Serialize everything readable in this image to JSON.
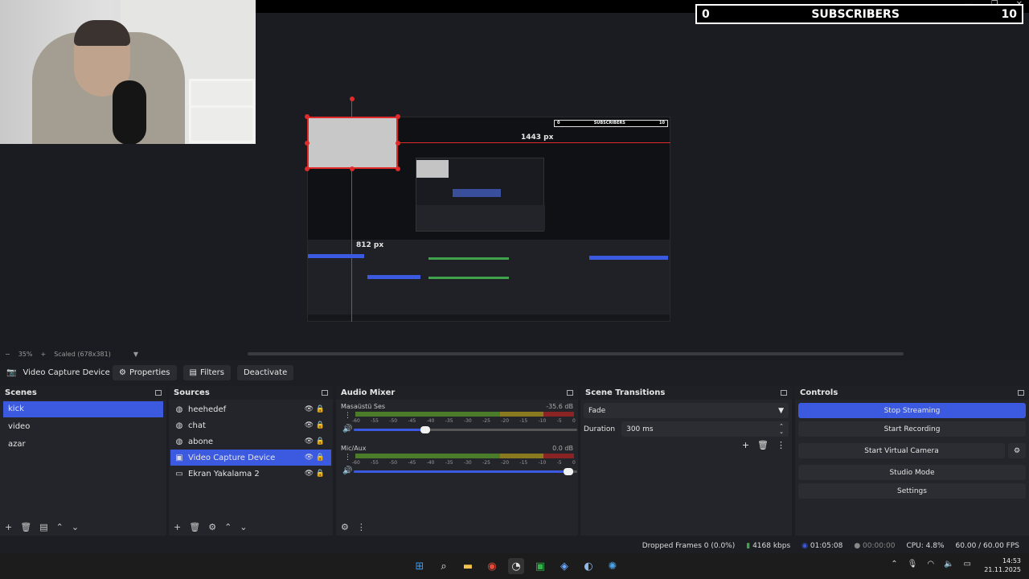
{
  "subscribers": {
    "left": "0",
    "label": "SUBSCRIBERS",
    "right": "10"
  },
  "canvas": {
    "width_label": "1443 px",
    "height_label": "812 px"
  },
  "zoombar": {
    "zoom_out": "−",
    "zoom": "35%",
    "zoom_in": "+",
    "scale": "Scaled (678x381)"
  },
  "source_toolbar": {
    "name": "Video Capture Device",
    "properties": "Properties",
    "filters": "Filters",
    "deactivate": "Deactivate"
  },
  "scenes": {
    "title": "Scenes",
    "items": [
      "kick",
      "video",
      "azar"
    ]
  },
  "sources": {
    "title": "Sources",
    "items": [
      "heehedef",
      "chat",
      "abone",
      "Video Capture Device",
      "Ekran Yakalama 2"
    ]
  },
  "mixer": {
    "title": "Audio Mixer",
    "channels": [
      {
        "name": "Masaüstü Ses",
        "db": "-35.6 dB",
        "volume": 0.32
      },
      {
        "name": "Mic/Aux",
        "db": "0.0 dB",
        "volume": 0.96
      }
    ],
    "ticks": [
      "-60",
      "-55",
      "-50",
      "-45",
      "-40",
      "-35",
      "-30",
      "-25",
      "-20",
      "-15",
      "-10",
      "-5",
      "0"
    ]
  },
  "transitions": {
    "title": "Scene Transitions",
    "type": "Fade",
    "duration_label": "Duration",
    "duration": "300 ms"
  },
  "controls": {
    "title": "Controls",
    "stop_streaming": "Stop Streaming",
    "start_recording": "Start Recording",
    "start_virtual_camera": "Start Virtual Camera",
    "studio_mode": "Studio Mode",
    "settings": "Settings"
  },
  "status": {
    "dropped": "Dropped Frames 0 (0.0%)",
    "bitrate": "4168 kbps",
    "stream_time": "01:05:08",
    "rec_time": "00:00:00",
    "cpu": "CPU: 4.8%",
    "fps": "60.00 / 60.00 FPS"
  },
  "clock": {
    "time": "14:53",
    "date": "21.11.2025"
  },
  "colors": {
    "accent": "#3c5adf",
    "guide": "#e02b2b"
  }
}
